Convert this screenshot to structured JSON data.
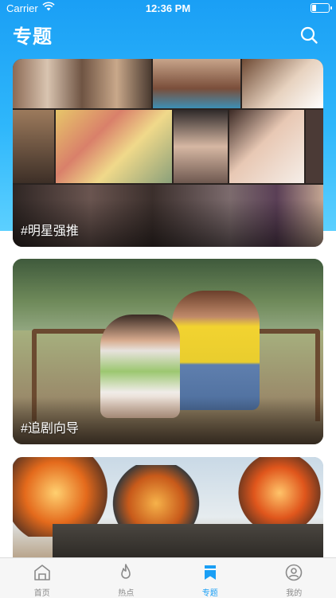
{
  "status_bar": {
    "carrier": "Carrier",
    "time": "12:36 PM"
  },
  "header": {
    "title": "专题"
  },
  "cards": [
    {
      "label": "#明星强推"
    },
    {
      "label": "#追剧向导"
    },
    {
      "label": ""
    }
  ],
  "tabbar": {
    "items": [
      {
        "label": "首页",
        "icon": "home-icon",
        "active": false
      },
      {
        "label": "热点",
        "icon": "flame-icon",
        "active": false
      },
      {
        "label": "专题",
        "icon": "bookmark-icon",
        "active": true
      },
      {
        "label": "我的",
        "icon": "profile-icon",
        "active": false
      }
    ]
  },
  "colors": {
    "accent": "#1a9ff5",
    "header_gradient_top": "#1a9ff5",
    "header_gradient_bottom": "#5cd0ff",
    "tab_inactive": "#8a8a8a"
  }
}
